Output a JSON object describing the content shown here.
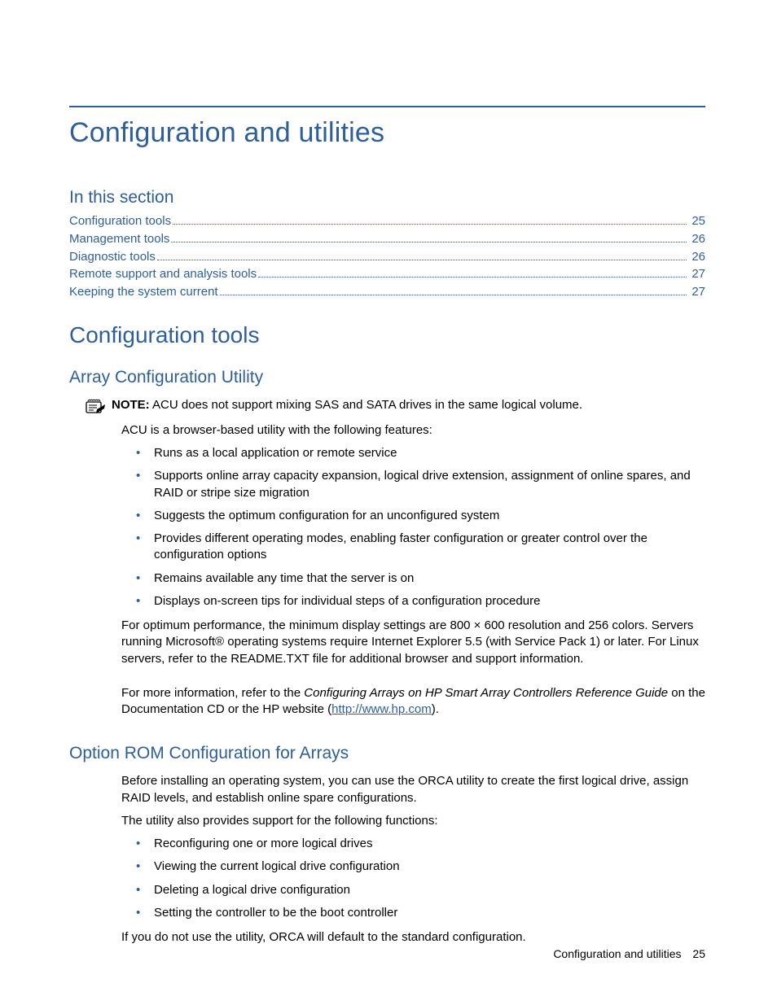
{
  "title": "Configuration and utilities",
  "in_this_section_label": "In this section",
  "toc": [
    {
      "label": "Configuration tools",
      "page": "25"
    },
    {
      "label": "Management tools",
      "page": "26"
    },
    {
      "label": "Diagnostic tools",
      "page": "26"
    },
    {
      "label": "Remote support and analysis tools",
      "page": "27"
    },
    {
      "label": "Keeping the system current",
      "page": "27"
    }
  ],
  "section1": {
    "heading": "Configuration tools",
    "sub1": {
      "heading": "Array Configuration Utility",
      "note_label": "NOTE:",
      "note_text": "ACU does not support mixing SAS and SATA drives in the same logical volume.",
      "intro": "ACU is a browser-based utility with the following features:",
      "bullets": [
        "Runs as a local application or remote service",
        "Supports online array capacity expansion, logical drive extension, assignment of online spares, and RAID or stripe size migration",
        "Suggests the optimum configuration for an unconfigured system",
        "Provides different operating modes, enabling faster configuration or greater control over the configuration options",
        "Remains available any time that the server is on",
        "Displays on-screen tips for individual steps of a configuration procedure"
      ],
      "para2": "For optimum performance, the minimum display settings are 800 × 600 resolution and 256 colors. Servers running Microsoft® operating systems require Internet Explorer 5.5 (with Service Pack 1) or later. For Linux servers, refer to the README.TXT file for additional browser and support information.",
      "para3_a": "For more information, refer to the ",
      "para3_em": "Configuring Arrays on HP Smart Array Controllers Reference Guide",
      "para3_b": " on the Documentation CD or the HP website (",
      "para3_link": "http://www.hp.com",
      "para3_c": ")."
    },
    "sub2": {
      "heading": "Option ROM Configuration for Arrays",
      "para1": "Before installing an operating system, you can use the ORCA utility to create the first logical drive, assign RAID levels, and establish online spare configurations.",
      "para2": "The utility also provides support for the following functions:",
      "bullets": [
        "Reconfiguring one or more logical drives",
        "Viewing the current logical drive configuration",
        "Deleting a logical drive configuration",
        "Setting the controller to be the boot controller"
      ],
      "para3": "If you do not use the utility, ORCA will default to the standard configuration."
    }
  },
  "footer": {
    "label": "Configuration and utilities",
    "page": "25"
  }
}
